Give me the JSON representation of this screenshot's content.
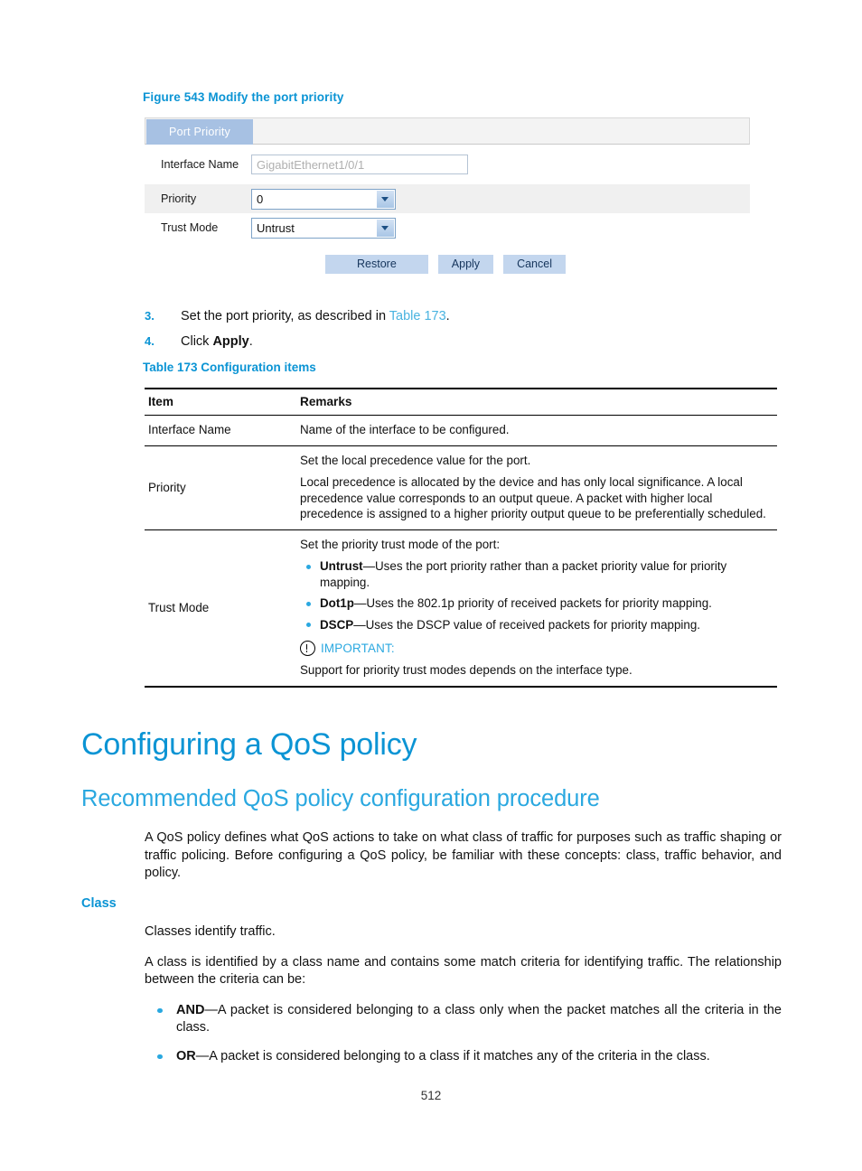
{
  "figure": {
    "caption": "Figure 543 Modify the port priority",
    "tab_label": "Port Priority",
    "fields": {
      "interface_name_label": "Interface Name",
      "interface_name_value": "GigabitEthernet1/0/1",
      "priority_label": "Priority",
      "priority_value": "0",
      "trust_mode_label": "Trust Mode",
      "trust_mode_value": "Untrust"
    },
    "buttons": {
      "restore": "Restore",
      "apply": "Apply",
      "cancel": "Cancel"
    }
  },
  "steps": [
    {
      "num": "3.",
      "pre": "Set the port priority, as described in ",
      "link": "Table 173",
      "post": "."
    },
    {
      "num": "4.",
      "pre": "Click ",
      "bold": "Apply",
      "post": "."
    }
  ],
  "table": {
    "caption": "Table 173 Configuration items",
    "headers": [
      "Item",
      "Remarks"
    ],
    "rows": [
      {
        "item": "Interface Name",
        "paragraphs": [
          "Name of the interface to be configured."
        ]
      },
      {
        "item": "Priority",
        "paragraphs": [
          "Set the local precedence value for the port.",
          "Local precedence is allocated by the device and has only local significance. A local precedence value corresponds to an output queue. A packet with higher local precedence is assigned to a higher priority output queue to be preferentially scheduled."
        ]
      },
      {
        "item": "Trust Mode",
        "intro": "Set the priority trust mode of the port:",
        "bullets": [
          {
            "term": "Untrust",
            "text": "—Uses the port priority rather than a packet priority value for priority mapping."
          },
          {
            "term": "Dot1p",
            "text": "—Uses the 802.1p priority of received packets for priority mapping."
          },
          {
            "term": "DSCP",
            "text": "—Uses the DSCP value of received packets for priority mapping."
          }
        ],
        "important_label": "IMPORTANT:",
        "important_text": "Support for priority trust modes depends on the interface type."
      }
    ]
  },
  "headings": {
    "h1": "Configuring a QoS policy",
    "h2": "Recommended QoS policy configuration procedure",
    "h3": "Class"
  },
  "intro": {
    "paragraph": "A QoS policy defines what QoS actions to take on what class of traffic for purposes such as traffic shaping or traffic policing. Before configuring a QoS policy, be familiar with these concepts: class, traffic behavior, and policy."
  },
  "class_section": {
    "p1": "Classes identify traffic.",
    "p2": "A class is identified by a class name and contains some match criteria for identifying traffic. The relationship between the criteria can be:",
    "bullets": [
      {
        "term": "AND",
        "text": "—A packet is considered belonging to a class only when the packet matches all the criteria in the class."
      },
      {
        "term": "OR",
        "text": "—A packet is considered belonging to a class if it matches any of the criteria in the class."
      }
    ]
  },
  "footer": {
    "page_number": "512"
  },
  "colors": {
    "accent_blue": "#0b94d4",
    "light_blue": "#2aa8e0",
    "link_blue": "#49b3e0",
    "tab_blue": "#a7c1e3",
    "button_blue": "#c3d6ee"
  }
}
